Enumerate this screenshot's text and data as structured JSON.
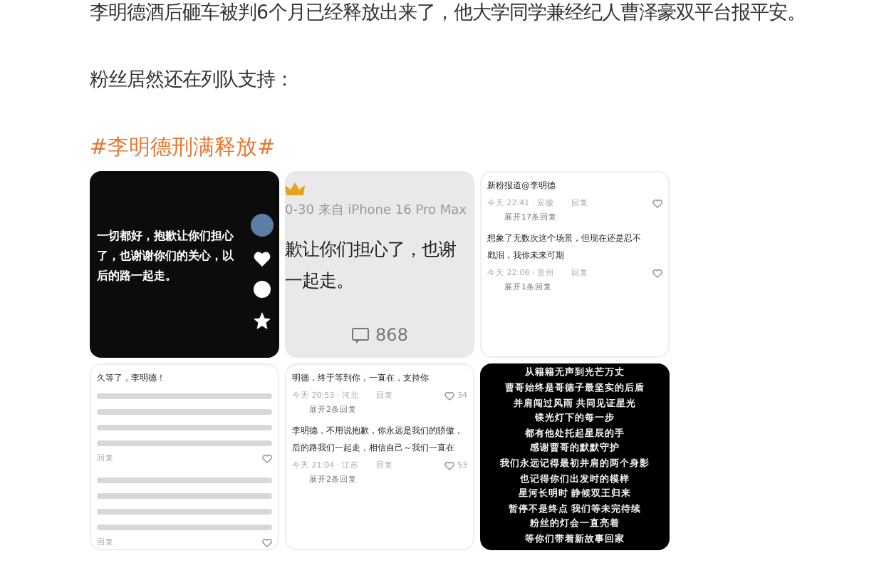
{
  "article": {
    "paragraphs": [
      "李明德酒后砸车被判6个月已经释放出来了，他大学同学兼经纪人曹泽豪双平台报平安。",
      "粉丝居然还在列队支持："
    ],
    "hashtag": "#李明德刑满释放#"
  },
  "images": [
    {
      "kind": "video",
      "lines": [
        "一切都好，抱歉让你们担心",
        "了，也谢谢你们的关心，以",
        "后的路一起走。"
      ]
    },
    {
      "kind": "post",
      "meta": "0-30  来自 iPhone 16 Pro Max",
      "lines": [
        "歉让你们担心了，也谢",
        "一起走。"
      ],
      "comment_count": "868"
    },
    {
      "kind": "comments",
      "comments": [
        {
          "lines": [
            "新粉报道@李明德"
          ],
          "meta": "今天 22:41 · 安徽",
          "reply": "回复",
          "expand": "展开17条回复",
          "blurred": false
        },
        {
          "lines": [
            "想象了无数次这个场景，但现在还是忍不",
            "戳泪，我你未来可期"
          ],
          "meta": "今天 22:08 · 贵州",
          "reply": "回复",
          "expand": "展开1条回复",
          "blurred": false
        }
      ]
    },
    {
      "kind": "comments",
      "comments": [
        {
          "lines": [
            "久等了，李明德！"
          ],
          "reply": "回复",
          "blurred": true
        },
        {
          "reply": "回复",
          "blurred": true
        }
      ]
    },
    {
      "kind": "comments",
      "comments": [
        {
          "lines": [
            "明德，终于等到你，一直在，支持你"
          ],
          "meta": "今天 20:53 · 河北",
          "reply": "回复",
          "likes": "34",
          "expand": "展开2条回复",
          "blurred": false
        },
        {
          "lines": [
            "李明德，不用说抱歉，你永远是我们的骄傲，",
            "后的路我们一起走，相信自己～我们一直在"
          ],
          "meta": "今天 21:04 · 江苏",
          "reply": "回复",
          "likes": "53",
          "expand": "展开2条回复",
          "blurred": false
        }
      ]
    },
    {
      "kind": "poem",
      "lines": [
        "从籍籍无声到光芒万丈",
        "曹哥始终是哥德子最坚实的后盾",
        "并肩闯过风雨 共同见证星光",
        "镁光灯下的每一步",
        "都有他处托起星辰的手",
        "感谢曹哥的默默守护",
        "我们永远记得最初并肩的两个身影",
        "也记得你们出发时的模样",
        "星河长明时 静候双王归来",
        "暂停不是终点 我们等未完待续",
        "粉丝的灯会一直亮着",
        "等你们带着新故事回家"
      ]
    }
  ]
}
